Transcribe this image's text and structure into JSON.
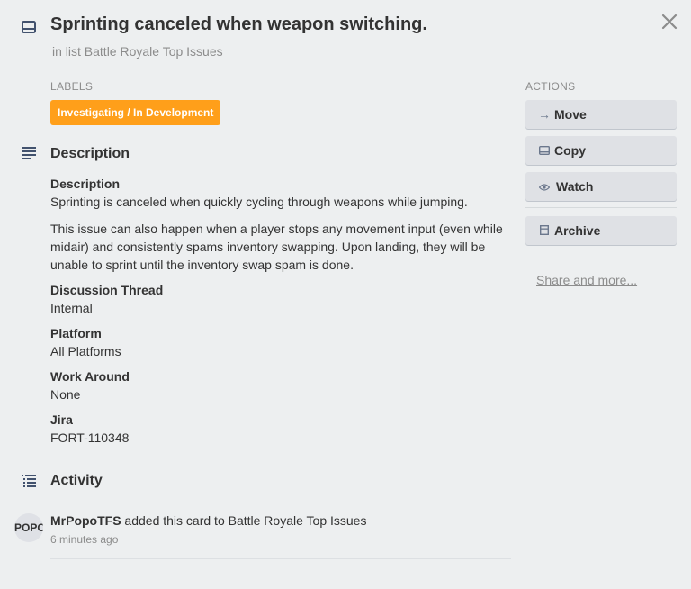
{
  "header": {
    "title": "Sprinting canceled when weapon switching.",
    "subtitle": "in list Battle Royale Top Issues"
  },
  "labels": {
    "heading": "LABELS",
    "items": [
      {
        "text": "Investigating / In Development",
        "color": "#ff9f1a"
      }
    ]
  },
  "description": {
    "heading": "Description",
    "blocks": [
      {
        "title": "Description",
        "paragraphs": [
          "Sprinting is canceled when quickly cycling through weapons while jumping.",
          "This issue can also happen when a player stops any movement input (even while midair) and consistently spams inventory swapping. Upon landing, they will be unable to sprint until the inventory swap spam is done."
        ]
      },
      {
        "title": "Discussion Thread",
        "paragraphs": [
          "Internal"
        ]
      },
      {
        "title": "Platform",
        "paragraphs": [
          "All Platforms"
        ]
      },
      {
        "title": "Work Around",
        "paragraphs": [
          "None"
        ]
      },
      {
        "title": "Jira",
        "paragraphs": [
          "FORT-110348"
        ]
      }
    ]
  },
  "activity": {
    "heading": "Activity",
    "entries": [
      {
        "avatar": "POPO",
        "user": "MrPopoTFS",
        "action": " added this card to Battle Royale Top Issues",
        "time": "6 minutes ago"
      }
    ]
  },
  "actions": {
    "heading": "ACTIONS",
    "move": "Move",
    "copy": "Copy",
    "watch": "Watch",
    "archive": "Archive",
    "share": "Share and more..."
  },
  "colors": {
    "accent": "#ff9f1a",
    "background": "#edeff0"
  },
  "icons": [
    "card-icon",
    "close-icon",
    "description-icon",
    "activity-icon",
    "arrow-right-icon",
    "copy-icon",
    "eye-icon",
    "archive-icon"
  ]
}
